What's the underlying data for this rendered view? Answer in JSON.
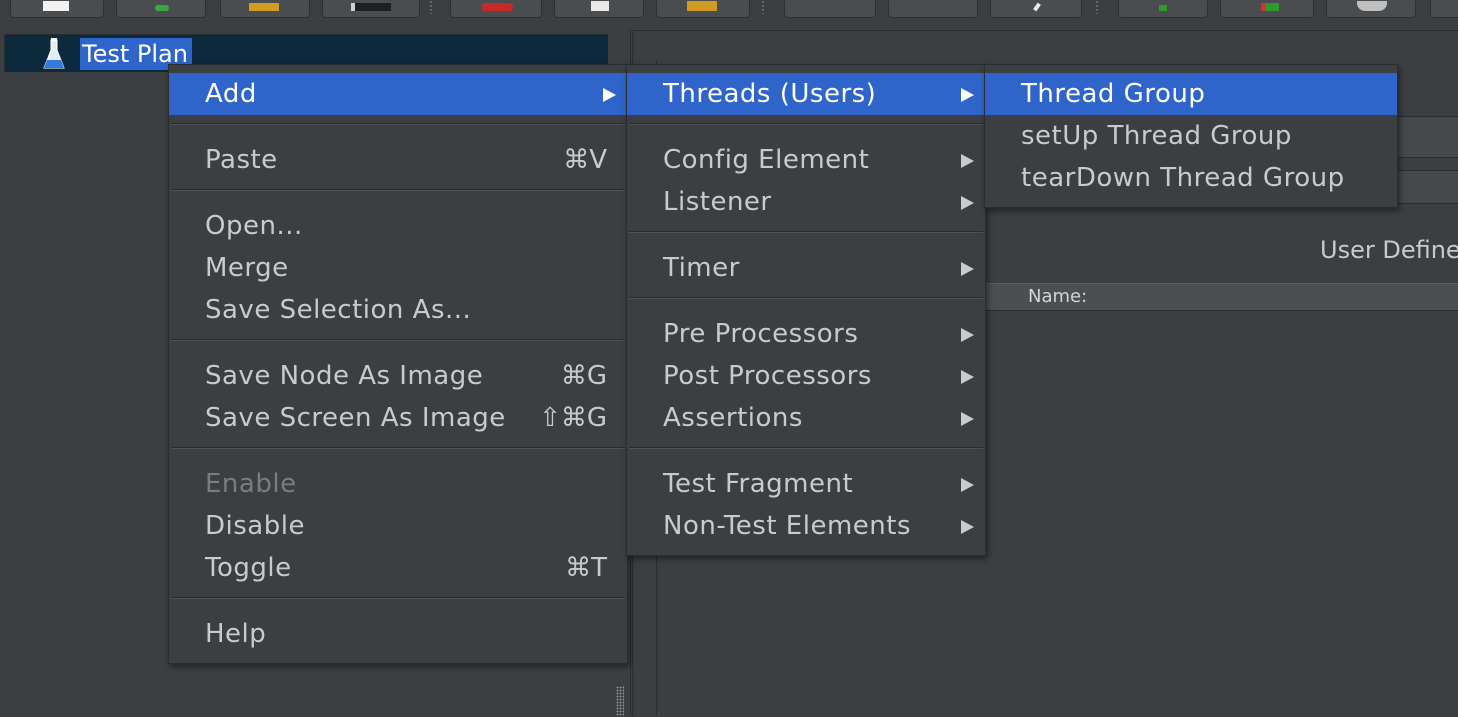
{
  "colors": {
    "background": "#3c3f41",
    "selection": "#2f65ca",
    "tree_row_background": "#0d293e",
    "text": "#c8cacc",
    "disabled_text": "#7a7d80"
  },
  "tree": {
    "icon": "test-plan-flask-icon",
    "root_label": "Test Plan"
  },
  "right_panel": {
    "user_defined_label": "User Define",
    "name_column_header": "Name:"
  },
  "context_menu": {
    "add": {
      "label": "Add",
      "submenu_icon": "submenu-arrow-icon"
    },
    "paste": {
      "label": "Paste",
      "shortcut": "⌘V"
    },
    "open": {
      "label": "Open..."
    },
    "merge": {
      "label": "Merge"
    },
    "save_selection_as": {
      "label": "Save Selection As..."
    },
    "save_node_as_image": {
      "label": "Save Node As Image",
      "shortcut": "⌘G"
    },
    "save_screen_as_image": {
      "label": "Save Screen As Image",
      "shortcut": "⇧⌘G"
    },
    "enable": {
      "label": "Enable",
      "state": "disabled"
    },
    "disable": {
      "label": "Disable"
    },
    "toggle": {
      "label": "Toggle",
      "shortcut": "⌘T"
    },
    "help": {
      "label": "Help"
    }
  },
  "add_submenu": {
    "threads_users": "Threads (Users)",
    "config_element": "Config Element",
    "listener": "Listener",
    "timer": "Timer",
    "pre_processors": "Pre Processors",
    "post_processors": "Post Processors",
    "assertions": "Assertions",
    "test_fragment": "Test Fragment",
    "non_test_elements": "Non-Test Elements"
  },
  "threads_submenu": {
    "thread_group": "Thread Group",
    "setup_thread_group": "setUp Thread Group",
    "teardown_thread_group": "tearDown Thread Group"
  }
}
